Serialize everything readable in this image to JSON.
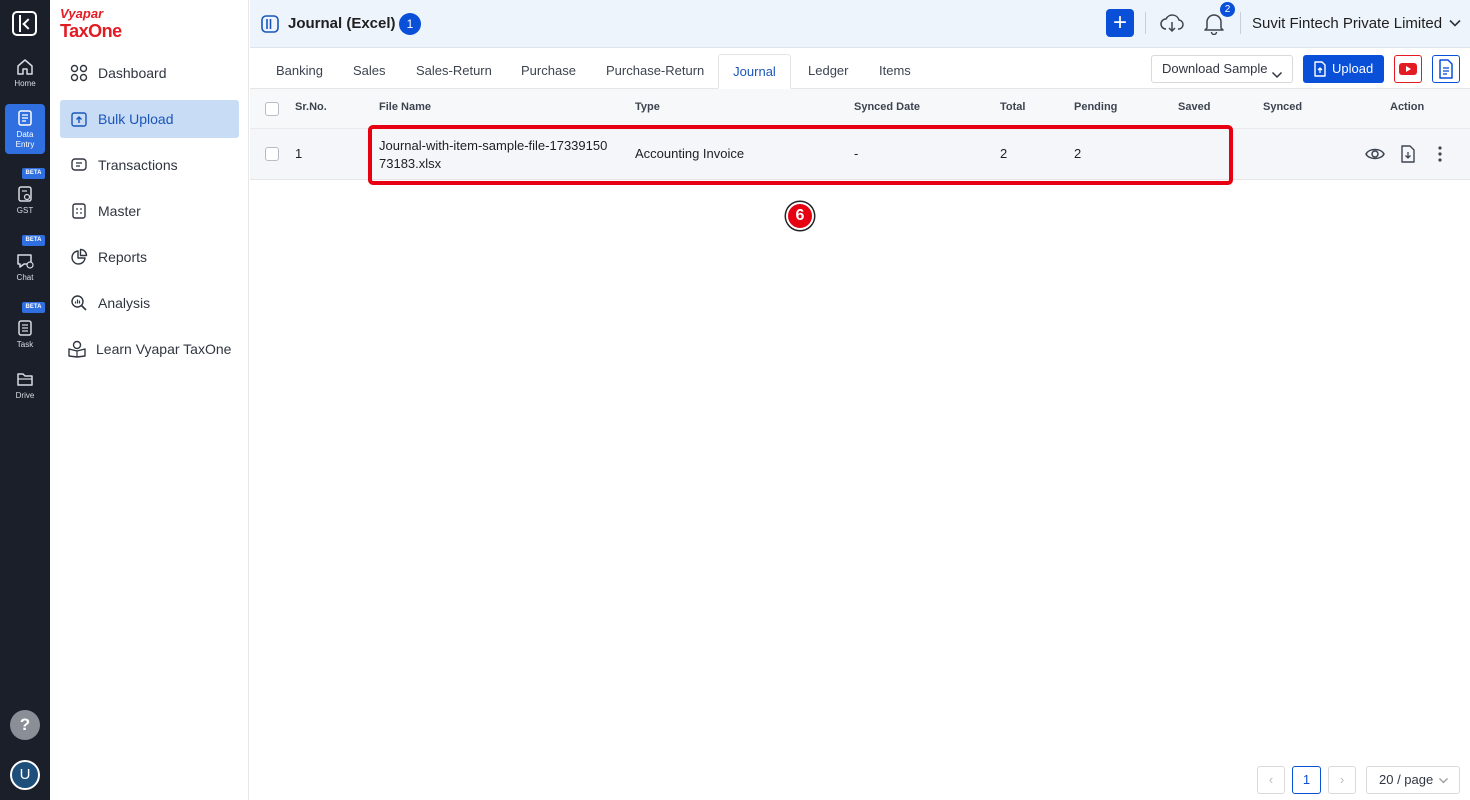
{
  "rail": {
    "items": [
      {
        "label": "Home",
        "icon": "home-icon"
      },
      {
        "label": "Data Entry",
        "icon": "data-entry-icon"
      },
      {
        "label": "GST",
        "icon": "gst-icon",
        "badge": "BETA"
      },
      {
        "label": "Chat",
        "icon": "chat-icon",
        "badge": "BETA"
      },
      {
        "label": "Task",
        "icon": "task-icon",
        "badge": "BETA"
      },
      {
        "label": "Drive",
        "icon": "folder-icon"
      }
    ],
    "help": "?",
    "avatar": "U"
  },
  "brand": {
    "top": "Vyapar",
    "main": "TaxOne",
    "color": "#e31b23"
  },
  "sidebar": {
    "items": [
      {
        "label": "Dashboard",
        "icon": "grid-icon"
      },
      {
        "label": "Bulk Upload",
        "icon": "upload-tray-icon",
        "active": true
      },
      {
        "label": "Transactions",
        "icon": "transactions-icon"
      },
      {
        "label": "Master",
        "icon": "master-icon"
      },
      {
        "label": "Reports",
        "icon": "pie-chart-icon"
      },
      {
        "label": "Analysis",
        "icon": "analysis-icon"
      },
      {
        "label": "Learn Vyapar TaxOne",
        "icon": "learn-icon"
      }
    ]
  },
  "header": {
    "title": "Journal (Excel)",
    "count": "1",
    "notifications": "2",
    "company": "Suvit Fintech Private Limited",
    "plus": "+"
  },
  "tabs": [
    "Banking",
    "Sales",
    "Sales-Return",
    "Purchase",
    "Purchase-Return",
    "Journal",
    "Ledger",
    "Items"
  ],
  "active_tab": "Journal",
  "toolbar": {
    "download_sample": "Download Sample",
    "upload": "Upload"
  },
  "table": {
    "columns": [
      "Sr.No.",
      "File Name",
      "Type",
      "Synced Date",
      "Total",
      "Pending",
      "Saved",
      "Synced",
      "Action"
    ],
    "rows": [
      {
        "srno": "1",
        "file_line1": "Journal-with-item-sample-file-17339150",
        "file_line2": "73183.xlsx",
        "type": "Accounting Invoice",
        "synced_date": "-",
        "total": "2",
        "pending": "2",
        "saved": "",
        "synced": ""
      }
    ]
  },
  "annotation": {
    "step": "6",
    "color": "#e60012"
  },
  "pagination": {
    "prev": "‹",
    "current": "1",
    "next": "›",
    "per_page": "20 / page"
  },
  "colors": {
    "accent": "#0a4fd8",
    "rail_bg": "#1b1f2a",
    "active_nav_bg": "#c9dcf6"
  }
}
